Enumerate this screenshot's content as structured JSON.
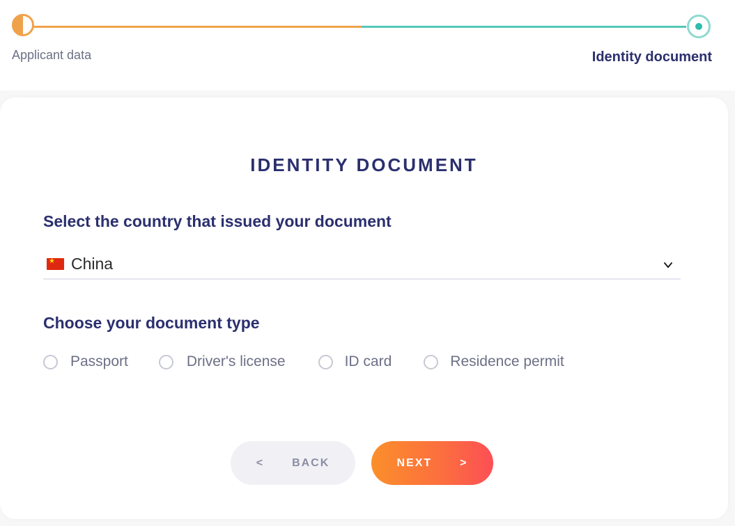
{
  "stepper": {
    "step1_label": "Applicant data",
    "step2_label": "Identity document",
    "colors": {
      "done": "#f0a24a",
      "todo": "#55c7b7"
    }
  },
  "card": {
    "title": "IDENTITY DOCUMENT",
    "country_label": "Select the country that issued your document",
    "country_select": {
      "value": "China",
      "flag_icon": "china-flag-icon",
      "dropdown_icon": "chevron-down-icon"
    },
    "doc_type_label": "Choose your document type",
    "doc_types": [
      {
        "label": "Passport",
        "selected": false
      },
      {
        "label": "Driver's license",
        "selected": false
      },
      {
        "label": "ID card",
        "selected": false
      },
      {
        "label": "Residence permit",
        "selected": false
      }
    ]
  },
  "buttons": {
    "back_arrow": "<",
    "back_label": "BACK",
    "next_label": "NEXT",
    "next_arrow": ">"
  },
  "colors": {
    "heading": "#2b2f6e",
    "muted_text": "#6c6f86",
    "next_gradient_start": "#fb8f2b",
    "next_gradient_end": "#fd4f55"
  }
}
